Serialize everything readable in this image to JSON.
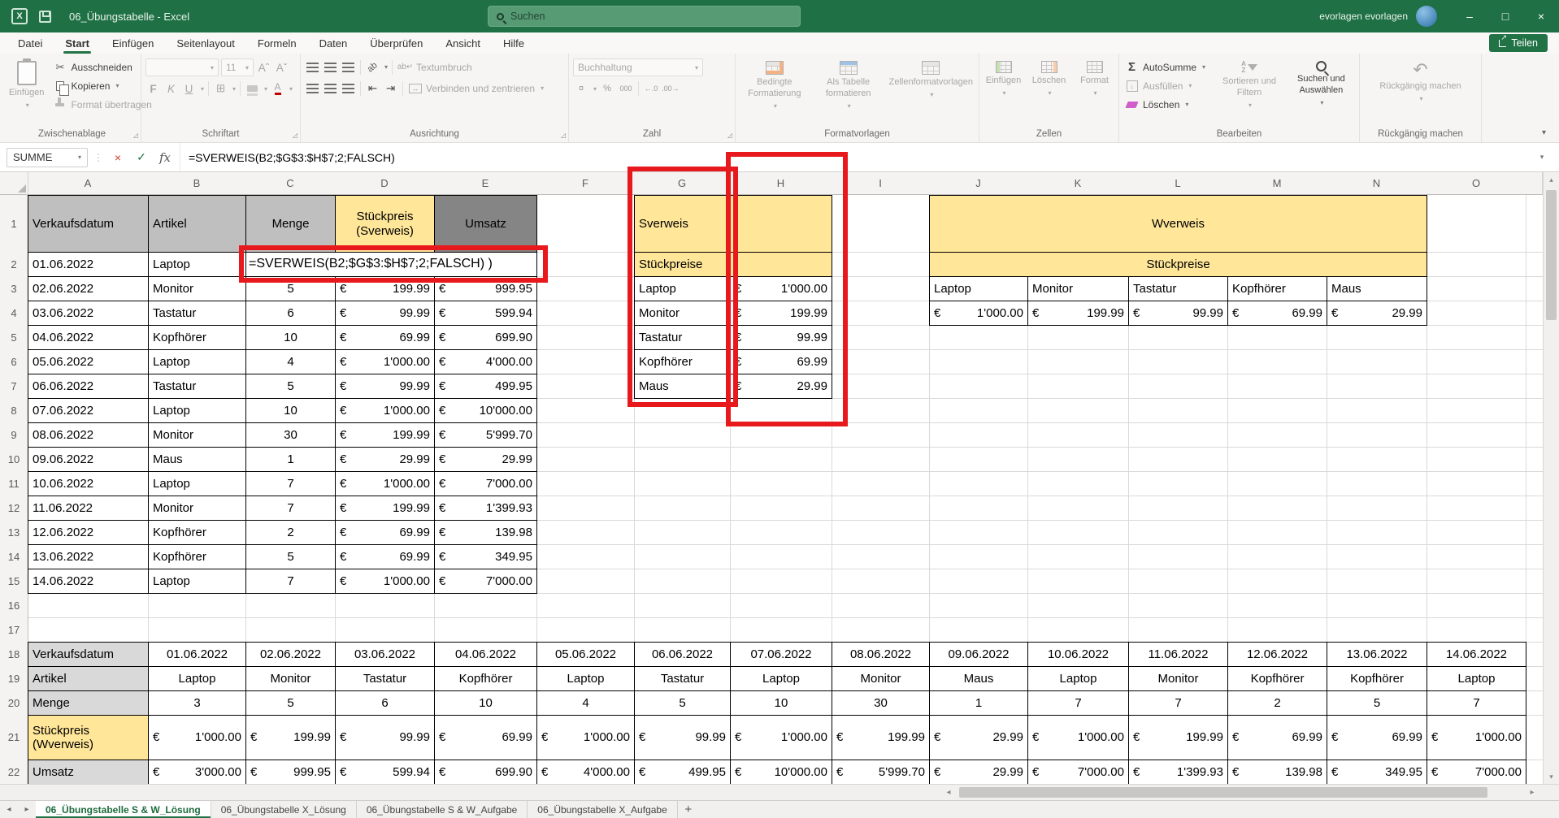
{
  "window": {
    "title": "06_Übungstabelle - Excel",
    "search_placeholder": "Suchen",
    "account_name": "evorlagen evorlagen",
    "controls": {
      "minimize": "–",
      "maximize": "□",
      "close": "×"
    }
  },
  "menubar": {
    "tabs": [
      "Datei",
      "Start",
      "Einfügen",
      "Seitenlayout",
      "Formeln",
      "Daten",
      "Überprüfen",
      "Ansicht",
      "Hilfe"
    ],
    "active_tab": "Start",
    "share_button": "Teilen"
  },
  "ribbon": {
    "clipboard": {
      "label": "Zwischenablage",
      "paste": "Einfügen",
      "cut": "Ausschneiden",
      "copy": "Kopieren",
      "format_painter": "Format übertragen"
    },
    "font": {
      "label": "Schriftart",
      "name": "",
      "size": "11",
      "bold": "F",
      "italic": "K",
      "underline": "U"
    },
    "alignment": {
      "label": "Ausrichtung",
      "wrap": "Textumbruch",
      "merge": "Verbinden und zentrieren"
    },
    "number": {
      "label": "Zahl",
      "format": "Buchhaltung"
    },
    "styles": {
      "label": "Formatvorlagen",
      "conditional": "Bedingte Formatierung",
      "as_table": "Als Tabelle formatieren",
      "cell_styles": "Zellenformatvorlagen"
    },
    "cells": {
      "label": "Zellen",
      "insert": "Einfügen",
      "delete": "Löschen",
      "format": "Format"
    },
    "editing": {
      "label": "Bearbeiten",
      "autosum": "AutoSumme",
      "fill": "Ausfüllen",
      "clear": "Löschen",
      "sort": "Sortieren und Filtern",
      "find": "Suchen und Auswählen"
    },
    "undo": {
      "label": "Rückgängig machen",
      "button": "Rückgängig machen"
    }
  },
  "formula_bar": {
    "name_box": "SUMME",
    "formula": "=SVERWEIS(B2;$G$3:$H$7;2;FALSCH)"
  },
  "icons": {
    "chevron": "▾",
    "launcher": "◿",
    "scissors": "✂",
    "dots": "⋮",
    "cancel": "×",
    "check": "✓",
    "fx": "fx",
    "grow_font": "Aˆ",
    "shrink_font": "Aˇ",
    "borders": "⊞",
    "orientation": "ab",
    "wrap": "ab↵",
    "merge_arrows": "↔",
    "currency": "¤",
    "percent": "%",
    "thousands": "000",
    "dec_inc": "←.0",
    "dec_dec": ".00→",
    "sum": "Σ",
    "fill_down": "↓",
    "undo": "↶",
    "tri_left": "◂",
    "tri_right": "▸",
    "tri_up": "▴",
    "tri_down": "▾",
    "add_sheet": "+"
  },
  "grid": {
    "column_letters": [
      "A",
      "B",
      "C",
      "D",
      "E",
      "F",
      "G",
      "H",
      "I",
      "J",
      "K",
      "L",
      "M",
      "N",
      "O"
    ],
    "row_count": 22,
    "currency_symbol": "€",
    "sales_table": {
      "headers": [
        "Verkaufsdatum",
        "Artikel",
        "Menge",
        "Stückpreis\n(Sverweis)",
        "Umsatz"
      ],
      "rows": [
        {
          "date": "01.06.2022",
          "article": "Laptop",
          "formula": "=SVERWEIS(B2;$G$3:$H$7;2;FALSCH) )"
        },
        {
          "date": "02.06.2022",
          "article": "Monitor",
          "qty": "5",
          "price": "199.99",
          "total": "999.95"
        },
        {
          "date": "03.06.2022",
          "article": "Tastatur",
          "qty": "6",
          "price": "99.99",
          "total": "599.94"
        },
        {
          "date": "04.06.2022",
          "article": "Kopfhörer",
          "qty": "10",
          "price": "69.99",
          "total": "699.90"
        },
        {
          "date": "05.06.2022",
          "article": "Laptop",
          "qty": "4",
          "price": "1'000.00",
          "total": "4'000.00"
        },
        {
          "date": "06.06.2022",
          "article": "Tastatur",
          "qty": "5",
          "price": "99.99",
          "total": "499.95"
        },
        {
          "date": "07.06.2022",
          "article": "Laptop",
          "qty": "10",
          "price": "1'000.00",
          "total": "10'000.00"
        },
        {
          "date": "08.06.2022",
          "article": "Monitor",
          "qty": "30",
          "price": "199.99",
          "total": "5'999.70"
        },
        {
          "date": "09.06.2022",
          "article": "Maus",
          "qty": "1",
          "price": "29.99",
          "total": "29.99"
        },
        {
          "date": "10.06.2022",
          "article": "Laptop",
          "qty": "7",
          "price": "1'000.00",
          "total": "7'000.00"
        },
        {
          "date": "11.06.2022",
          "article": "Monitor",
          "qty": "7",
          "price": "199.99",
          "total": "1'399.93"
        },
        {
          "date": "12.06.2022",
          "article": "Kopfhörer",
          "qty": "2",
          "price": "69.99",
          "total": "139.98"
        },
        {
          "date": "13.06.2022",
          "article": "Kopfhörer",
          "qty": "5",
          "price": "69.99",
          "total": "349.95"
        },
        {
          "date": "14.06.2022",
          "article": "Laptop",
          "qty": "7",
          "price": "1'000.00",
          "total": "7'000.00"
        }
      ]
    },
    "sverweis_table": {
      "title": "Sverweis",
      "subtitle": "Stückpreise",
      "rows": [
        [
          "Laptop",
          "1'000.00"
        ],
        [
          "Monitor",
          "199.99"
        ],
        [
          "Tastatur",
          "99.99"
        ],
        [
          "Kopfhörer",
          "69.99"
        ],
        [
          "Maus",
          "29.99"
        ]
      ]
    },
    "wverweis_table": {
      "title": "Wverweis",
      "subtitle": "Stückpreise",
      "articles": [
        "Laptop",
        "Monitor",
        "Tastatur",
        "Kopfhörer",
        "Maus"
      ],
      "prices": [
        "1'000.00",
        "199.99",
        "99.99",
        "69.99",
        "29.99"
      ]
    },
    "bottom_table": {
      "row_labels": [
        "Verkaufsdatum",
        "Artikel",
        "Menge",
        "Stückpreis\n(Wverweis)",
        "Umsatz"
      ],
      "dates": [
        "01.06.2022",
        "02.06.2022",
        "03.06.2022",
        "04.06.2022",
        "05.06.2022",
        "06.06.2022",
        "07.06.2022",
        "08.06.2022",
        "09.06.2022",
        "10.06.2022",
        "11.06.2022",
        "12.06.2022",
        "13.06.2022",
        "14.06.2022"
      ],
      "articles": [
        "Laptop",
        "Monitor",
        "Tastatur",
        "Kopfhörer",
        "Laptop",
        "Tastatur",
        "Laptop",
        "Monitor",
        "Maus",
        "Laptop",
        "Monitor",
        "Kopfhörer",
        "Kopfhörer",
        "Laptop"
      ],
      "qty": [
        "3",
        "5",
        "6",
        "10",
        "4",
        "5",
        "10",
        "30",
        "1",
        "7",
        "7",
        "2",
        "5",
        "7"
      ],
      "prices": [
        "1'000.00",
        "199.99",
        "99.99",
        "69.99",
        "1'000.00",
        "99.99",
        "1'000.00",
        "199.99",
        "29.99",
        "1'000.00",
        "199.99",
        "69.99",
        "69.99",
        "1'000.00"
      ],
      "totals": [
        "3'000.00",
        "999.95",
        "599.94",
        "699.90",
        "4'000.00",
        "499.95",
        "10'000.00",
        "5'999.70",
        "29.99",
        "7'000.00",
        "1'399.93",
        "139.98",
        "349.95",
        "7'000.00"
      ]
    }
  },
  "annotations": {
    "color": "#e8191c",
    "boxes": [
      "formula-cell-highlight",
      "sverweis-lookup-column-highlight",
      "sverweis-price-column-highlight"
    ]
  },
  "sheet_tabs": {
    "tabs": [
      "06_Übungstabelle S & W_Lösung",
      "06_Übungstabelle X_Lösung",
      "06_Übungstabelle S & W_Aufgabe",
      "06_Übungstabelle X_Aufgabe"
    ],
    "active": 0
  },
  "colors": {
    "excel_green": "#217346",
    "titlebar_green": "#1f7044",
    "header_gray": "#bfbfbf",
    "header_dark": "#858585",
    "header_yellow": "#ffe699",
    "label_gray": "#d9d9d9",
    "annotation_red": "#e8191c",
    "grid_line": "#d9d9d9"
  }
}
